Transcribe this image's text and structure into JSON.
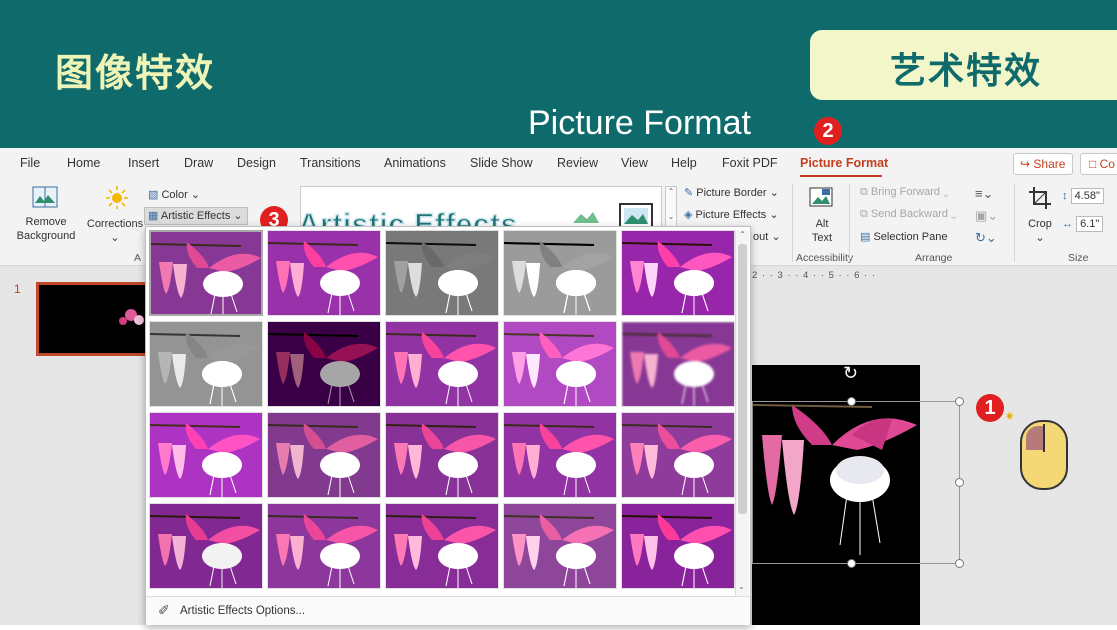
{
  "banner": {
    "title": "图像特效",
    "tag": "艺术特效",
    "subtitle": "Picture Format",
    "badges": [
      "1",
      "2",
      "3"
    ]
  },
  "colors": {
    "banner_bg": "#0f6b6b",
    "banner_title": "#eef3b6",
    "tag_bg": "#f3f6c8",
    "accent": "#c43e1c",
    "badge": "#e02020"
  },
  "menu": {
    "tabs": [
      "File",
      "Home",
      "Insert",
      "Draw",
      "Design",
      "Transitions",
      "Animations",
      "Slide Show",
      "Review",
      "View",
      "Help",
      "Foxit PDF",
      "Picture Format"
    ],
    "active_tab": "Picture Format",
    "share": "Share",
    "comments": "Co"
  },
  "ribbon": {
    "remove_background": [
      "Remove",
      "Background"
    ],
    "corrections": "Corrections",
    "color": "Color",
    "artistic_effects": "Artistic Effects",
    "artistic_callout": "Artistic Effects",
    "adjust_group_partial": "A",
    "picture_border": "Picture Border",
    "picture_effects": "Picture Effects",
    "layout_partial": "out",
    "alt_text": [
      "Alt",
      "Text"
    ],
    "accessibility": "Accessibility",
    "bring_forward": "Bring Forward",
    "send_backward": "Send Backward",
    "selection_pane": "Selection Pane",
    "arrange": "Arrange",
    "crop": "Crop",
    "height": "4.58\"",
    "width": "6.1\"",
    "size": "Size"
  },
  "work_area": {
    "ruler": "2 · · 3 · · 4 · · 5 · · 6 · ·",
    "slide_number": "1"
  },
  "gallery": {
    "options_label": "Artistic Effects Options...",
    "rows": 4,
    "cols": 5,
    "effects": [
      "none",
      "marker",
      "pencil-grayscale",
      "pencil-sketch",
      "line-drawing",
      "chalk-sketch",
      "paint-strokes",
      "paint-brush",
      "glow-diffused",
      "blur",
      "light-screen",
      "watercolor-sponge",
      "film-grain",
      "mosaic-bubbles",
      "glass",
      "cement",
      "texturizer",
      "crisscross-etching",
      "pastels-smooth",
      "plastic-wrap"
    ]
  }
}
